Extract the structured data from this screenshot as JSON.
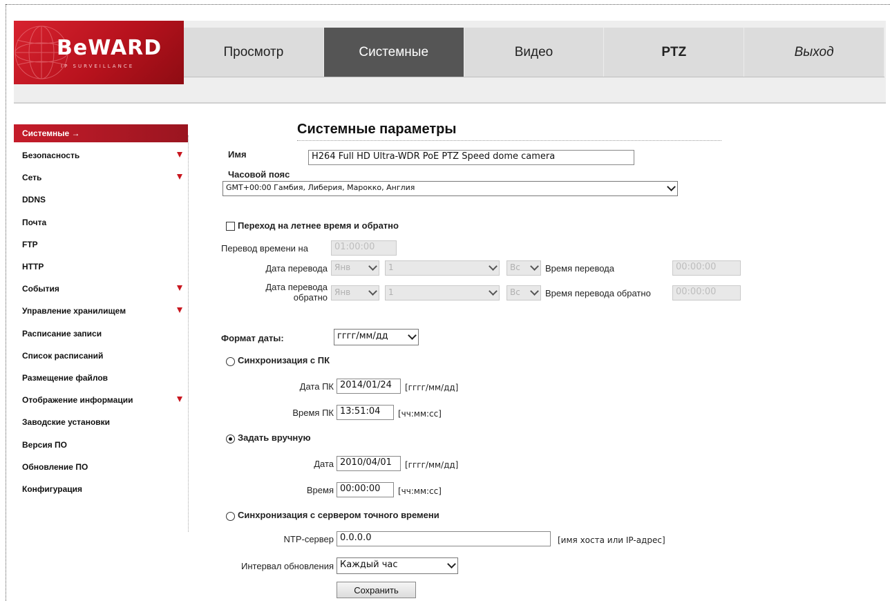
{
  "logo": {
    "text": "BeWARD",
    "subtitle": "IP SURVEILLANCE"
  },
  "nav": {
    "items": [
      {
        "label": "Просмотр"
      },
      {
        "label": "Системные"
      },
      {
        "label": "Видео"
      },
      {
        "label": "PTZ"
      },
      {
        "label": "Выход"
      }
    ],
    "active": "Системные"
  },
  "sidebar": {
    "items": [
      {
        "label": "Системные →",
        "active": true,
        "has_submenu": false
      },
      {
        "label": "Безопасность",
        "has_submenu": true
      },
      {
        "label": "Сеть",
        "has_submenu": true
      },
      {
        "label": "DDNS",
        "has_submenu": false
      },
      {
        "label": "Почта",
        "has_submenu": false
      },
      {
        "label": "FTP",
        "has_submenu": false
      },
      {
        "label": "HTTP",
        "has_submenu": false
      },
      {
        "label": "События",
        "has_submenu": true
      },
      {
        "label": "Управление хранилищем",
        "has_submenu": true
      },
      {
        "label": "Расписание записи",
        "has_submenu": false
      },
      {
        "label": "Список расписаний",
        "has_submenu": false
      },
      {
        "label": "Размещение файлов",
        "has_submenu": false
      },
      {
        "label": "Отображение информации",
        "has_submenu": true
      },
      {
        "label": "Заводские установки",
        "has_submenu": false
      },
      {
        "label": "Версия ПО",
        "has_submenu": false
      },
      {
        "label": "Обновление ПО",
        "has_submenu": false
      },
      {
        "label": "Конфигурация",
        "has_submenu": false
      }
    ],
    "accent_color": "#c51c2a"
  },
  "main": {
    "title": "Системные параметры",
    "name": {
      "label": "Имя",
      "value": "H264 Full HD Ultra-WDR PoE PTZ Speed dome camera"
    },
    "timezone": {
      "label": "Часовой пояс",
      "value": "GMT+00:00 Гамбия, Либерия, Марокко, Англия"
    },
    "dst": {
      "label": "Переход на летнее время и обратно",
      "checked": false,
      "shift_label": "Перевод времени на",
      "shift_value": "01:00:00",
      "start_date_label": "Дата перевода",
      "start_month": "Янв",
      "start_day": "1",
      "start_weekday": "Вс",
      "start_time_label": "Время перевода",
      "start_time": "00:00:00",
      "end_date_label_1": "Дата перевода",
      "end_date_label_2": "обратно",
      "end_month": "Янв",
      "end_day": "1",
      "end_weekday": "Вс",
      "end_time_label": "Время перевода обратно",
      "end_time": "00:00:00"
    },
    "date_format": {
      "label": "Формат даты:",
      "value": "гггг/мм/дд"
    },
    "sync_pc": {
      "label": "Синхронизация с ПК",
      "selected": false,
      "date_label": "Дата ПК",
      "date_value": "2014/01/24",
      "date_hint": "[гггг/мм/дд]",
      "time_label": "Время ПК",
      "time_value": "13:51:04",
      "time_hint": "[чч:мм:сс]"
    },
    "manual": {
      "label": "Задать вручную",
      "selected": true,
      "date_label": "Дата",
      "date_value": "2010/04/01",
      "date_hint": "[гггг/мм/дд]",
      "time_label": "Время",
      "time_value": "00:00:00",
      "time_hint": "[чч:мм:сс]"
    },
    "ntp": {
      "label": "Синхронизация с сервером точного времени",
      "selected": false,
      "server_label": "NTP-сервер",
      "server_value": "0.0.0.0",
      "server_hint": "[имя хоста или IP-адрес]",
      "interval_label": "Интервал обновления",
      "interval_value": "Каждый час"
    },
    "save_label": "Сохранить"
  }
}
